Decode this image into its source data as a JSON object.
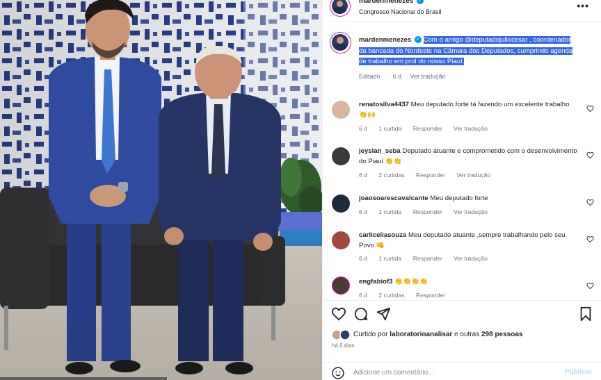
{
  "post": {
    "author": "mardenmenezes",
    "location": "Congresso Nacional do Brasil",
    "more_label": "•••",
    "photo_alt": ""
  },
  "caption": {
    "username": "mardenmenezes",
    "text": "Com o amigo @deputadojuliocesar , coordenador da bancada do Nordeste na Câmara dos Deputados, cumprindo agenda de trabalho em prol do nosso Piauí.",
    "edited": "Editado",
    "age": "6 d",
    "translate": "Ver tradução"
  },
  "comments": [
    {
      "username": "renatosilva4437",
      "text": "Meu deputado forte tá fazendo um excelente trabalho 👏🙌",
      "age": "6 d",
      "likes": "1 curtida",
      "reply": "Responder",
      "translate": "Ver tradução"
    },
    {
      "username": "jeyslan_seba",
      "text": "Deputado atuante e comprometido com o desenvolvimento do Piauí 👏👏",
      "age": "6 d",
      "likes": "2 curtidas",
      "reply": "Responder",
      "translate": "Ver tradução"
    },
    {
      "username": "joaosoarescavalcante",
      "text": "Meu deputado forte",
      "age": "6 d",
      "likes": "1 curtida",
      "reply": "Responder",
      "translate": "Ver tradução"
    },
    {
      "username": "carliceliasouza",
      "text": "Meu deputado atuante ,sempre trabalhando pelo seu Povo 👊",
      "age": "6 d",
      "likes": "1 curtida",
      "reply": "Responder",
      "translate": "Ver tradução"
    },
    {
      "username": "engfabiof3",
      "text": "👏👏👏👏",
      "age": "6 d",
      "likes": "2 curtidas",
      "reply": "Responder",
      "translate": ""
    }
  ],
  "likes": {
    "prefix": "Curtido por",
    "user": "laboratorioanalisar",
    "suffix": "e outras",
    "count": "298 pessoas"
  },
  "posted_ago": "há 6 dias",
  "comment_box": {
    "placeholder": "Adicione um comentário...",
    "publish_label": "Publicar"
  },
  "icons": [
    "heart-icon",
    "comment-icon",
    "share-icon",
    "bookmark-icon",
    "emoji-icon",
    "verified-badge-icon"
  ],
  "colors": {
    "highlight": "#3667e6",
    "link": "#0095f6",
    "muted": "#737373"
  }
}
